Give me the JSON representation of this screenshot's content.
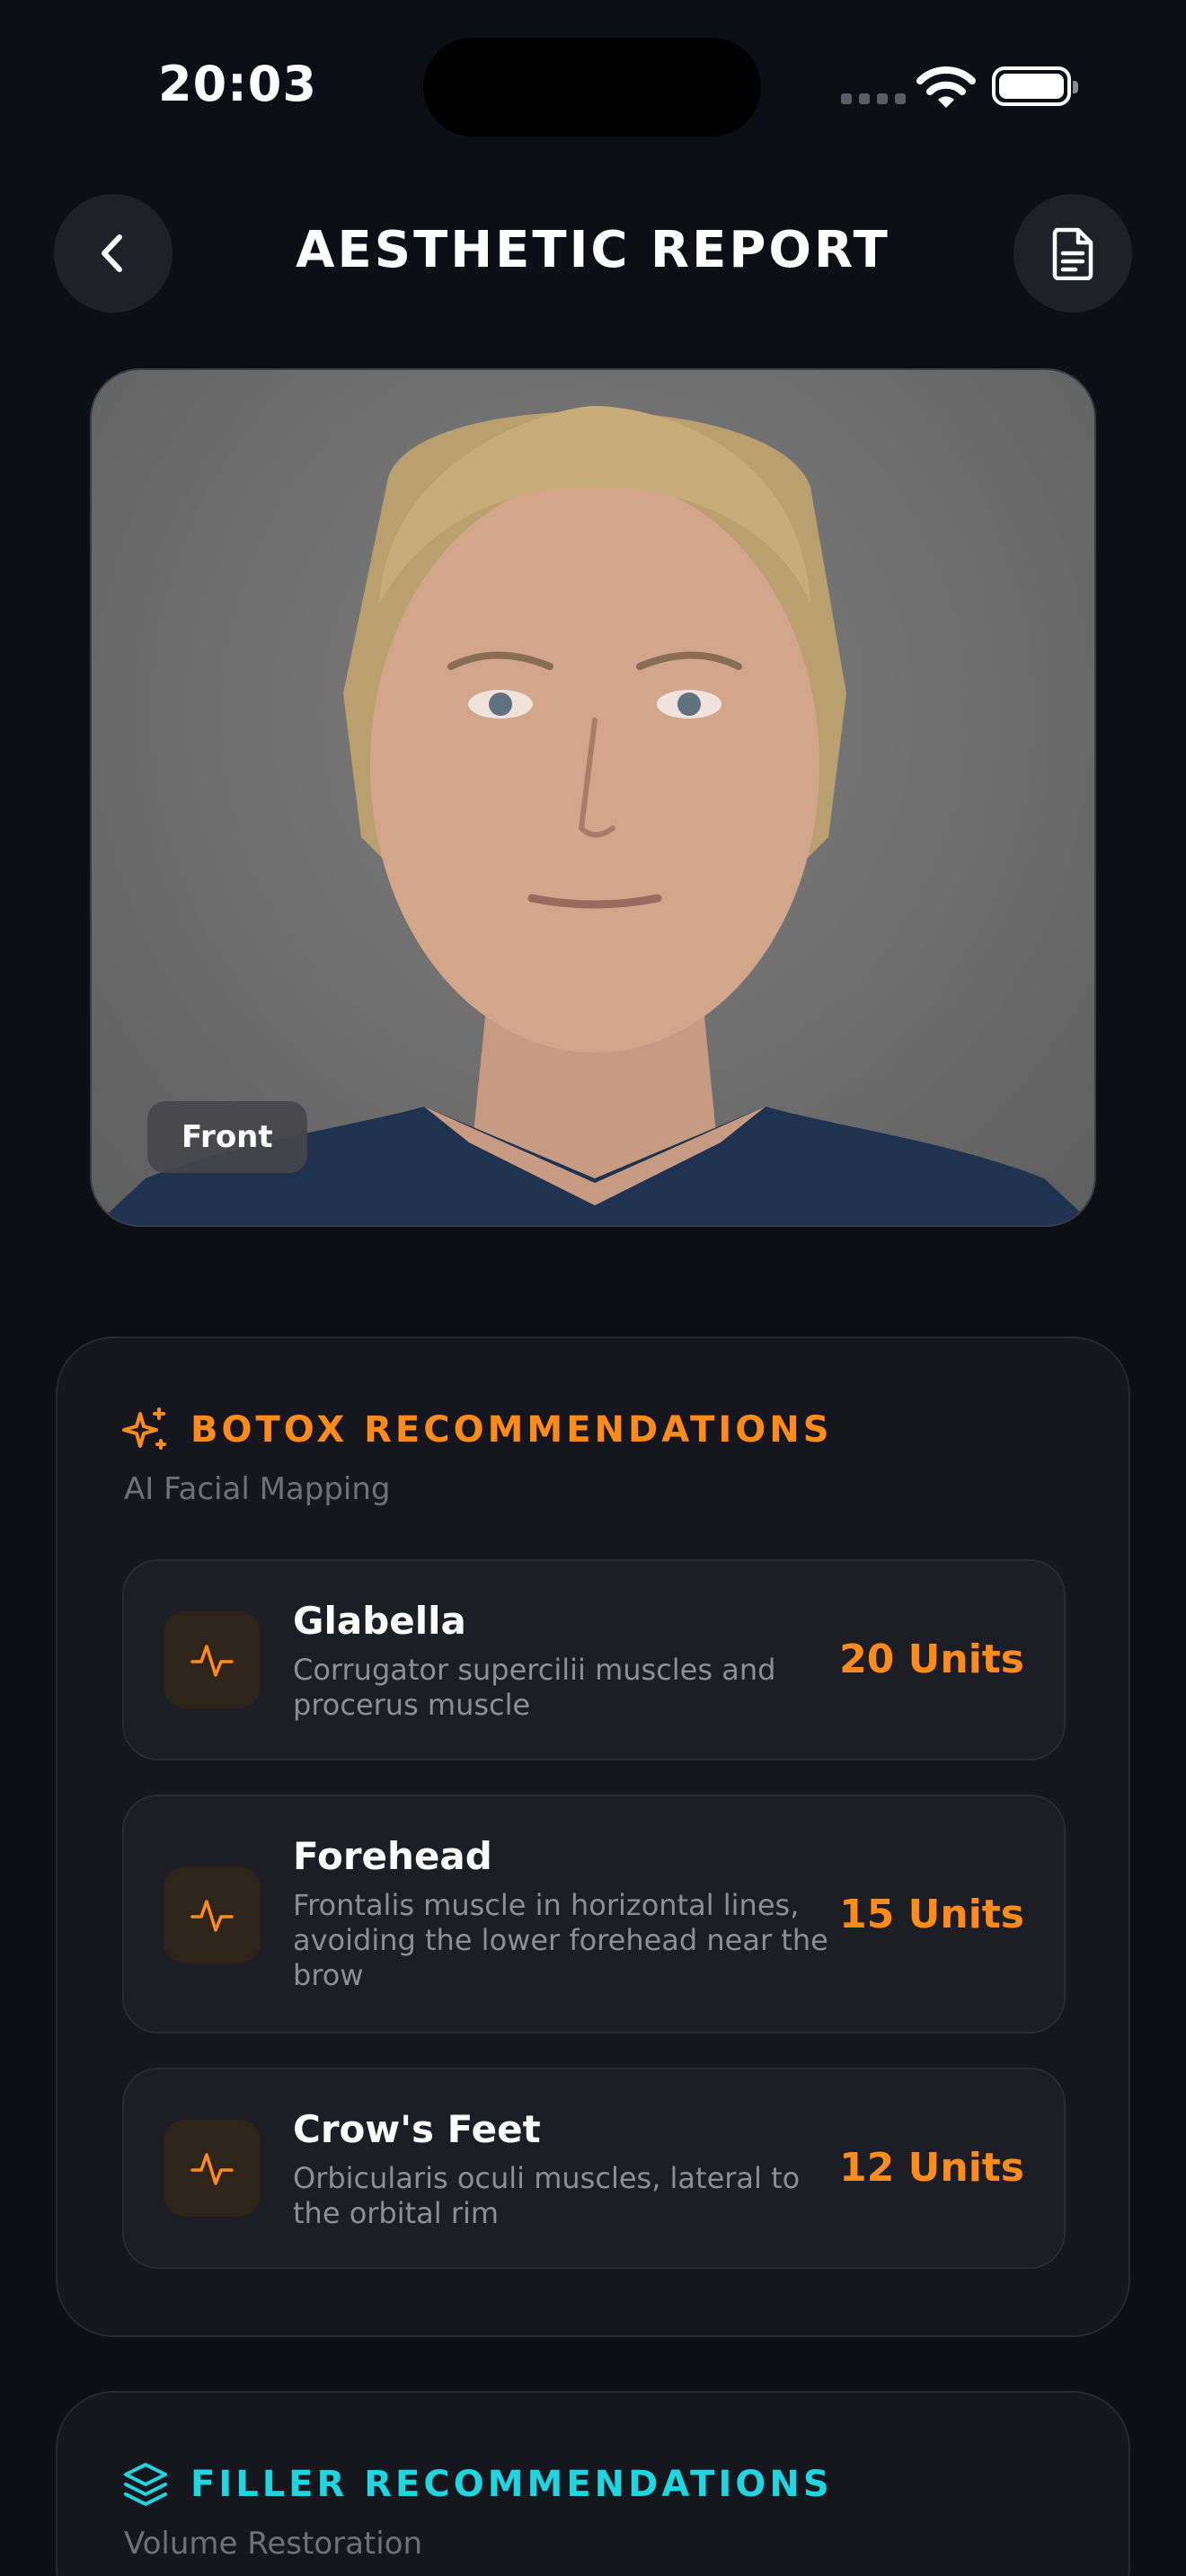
{
  "status_bar": {
    "time": "20:03"
  },
  "header": {
    "title": "AESTHETIC REPORT"
  },
  "photo": {
    "view_label": "Front"
  },
  "botox": {
    "title": "BOTOX RECOMMENDATIONS",
    "subtitle": "AI Facial Mapping",
    "items": [
      {
        "name": "Glabella",
        "description": "Corrugator supercilii muscles and procerus muscle",
        "units": "20 Units"
      },
      {
        "name": "Forehead",
        "description": "Frontalis muscle in horizontal lines, avoiding the lower forehead near the brow",
        "units": "15 Units"
      },
      {
        "name": "Crow's Feet",
        "description": "Orbicularis oculi muscles, lateral to the orbital rim",
        "units": "12 Units"
      }
    ]
  },
  "filler": {
    "title": "FILLER RECOMMENDATIONS",
    "subtitle": "Volume Restoration"
  },
  "colors": {
    "accent_orange": "#ff8c1a",
    "accent_cyan": "#1fd6e0",
    "background": "#0e0f16"
  },
  "icons": {
    "back": "chevron-left-icon",
    "report": "document-icon",
    "botox": "sparkles-icon",
    "item": "pulse-icon",
    "filler": "layers-icon"
  }
}
